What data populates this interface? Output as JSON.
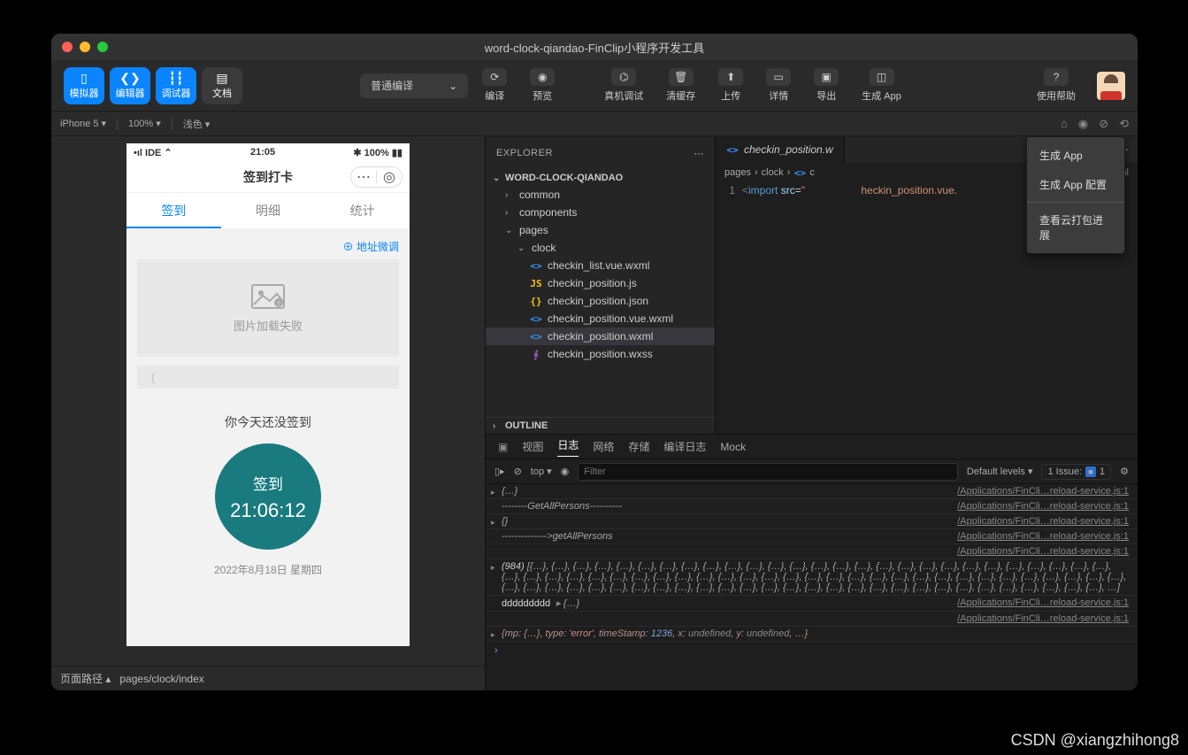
{
  "window": {
    "title": "word-clock-qiandao-FinClip小程序开发工具"
  },
  "toolbar": {
    "pills": {
      "simulator": "模拟器",
      "editor": "编辑器",
      "debugger": "调试器",
      "docs": "文档"
    },
    "compile_mode": "普通编译",
    "buttons": {
      "compile": "编译",
      "preview": "预览",
      "real_device": "真机调试",
      "clear_cache": "清缓存",
      "upload": "上传",
      "details": "详情",
      "export": "导出",
      "gen_app": "生成 App",
      "help": "使用帮助"
    }
  },
  "subbar": {
    "device": "iPhone 5",
    "zoom": "100%",
    "theme": "浅色"
  },
  "simulator": {
    "status_left": "•ıl IDE ⌃",
    "status_center": "21:05",
    "status_right": "✱ 100% ▮▮",
    "nav_title": "签到打卡",
    "tabs": {
      "sign": "签到",
      "detail": "明细",
      "stats": "统计"
    },
    "adjust": "⊕ 地址微调",
    "img_fail": "图片加载失败",
    "signal_cell": "〔",
    "not_signed": "你今天还没签到",
    "sign_button": "签到",
    "sign_time": "21:06:12",
    "date": "2022年8月18日 星期四",
    "footer_label": "页面路径",
    "footer_path": "pages/clock/index"
  },
  "explorer": {
    "header": "EXPLORER",
    "project": "WORD-CLOCK-QIANDAO",
    "outline": "OUTLINE",
    "folders": {
      "common": "common",
      "components": "components",
      "pages": "pages",
      "clock": "clock"
    },
    "files": {
      "f1": "checkin_list.vue.wxml",
      "f2": "checkin_position.js",
      "f3": "checkin_position.json",
      "f4": "checkin_position.vue.wxml",
      "f5": "checkin_position.wxml",
      "f6": "checkin_position.wxss"
    }
  },
  "editor": {
    "tab_name": "checkin_position.w",
    "breadcrumb_tail": "xml",
    "breadcrumb": {
      "a": "pages",
      "b": "clock",
      "c": "c"
    },
    "line_no": "1",
    "code_import": "import",
    "code_src": "src",
    "code_str": "heckin_position.vue."
  },
  "dropdown": {
    "a": "生成 App",
    "b": "生成 App 配置",
    "c": "查看云打包进展"
  },
  "console": {
    "tabs": {
      "view": "视图",
      "log": "日志",
      "net": "网络",
      "store": "存储",
      "compile_log": "编译日志",
      "mock": "Mock"
    },
    "top": "top",
    "filter_placeholder": "Filter",
    "levels": "Default levels",
    "issue_label": "1 Issue:",
    "issue_count": "1",
    "src": "/Applications/FinCli…reload-service.js:1",
    "logs": {
      "l1": "{…}",
      "l2": "--------GetAllPersons----------",
      "l3": "{}",
      "l4": "-------------->getAllPersons",
      "l5_pre": "(984) ",
      "l5": "[{…}, {…}, {…}, {…}, {…}, {…}, {…}, {…}, {…}, {…}, {…}, {…}, {…}, {…}, {…}, {…}, {…}, {…}, {…}, {…}, {…}, {…}, {…}, {…}, {…}, {…}, {…}, {…}, {…}, {…}, {…}, {…}, {…}, {…}, {…}, {…}, {…}, {…}, {…}, {…}, {…}, {…}, {…}, {…}, {…}, {…}, {…}, {…}, {…}, {…}, {…}, {…}, {…}, {…}, {…}, {…}, {…}, {…}, {…}, {…}, {…}, {…}, {…}, {…}, {…}, {…}, {…}, {…}, {…}, {…}, {…}, {…}, {…}, {…}, {…}, {…}, {…}, {…}, {…}, {…}, {…}, {…}, {…}, {…}, …]",
      "l6a": "ddddddddd",
      "l6b": "{…}",
      "l7_mp": "mp",
      "l7_type": "type",
      "l7_err": "'error'",
      "l7_ts": "timeStamp",
      "l7_tsnum": "1236",
      "l7_x": "x",
      "l7_xv": "undefined",
      "l7_y": "y",
      "l7_yv": "undefined"
    }
  },
  "watermark": "CSDN @xiangzhihong8"
}
